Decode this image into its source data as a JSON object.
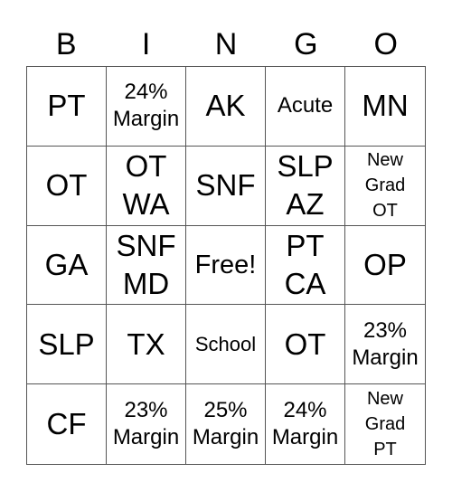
{
  "header": {
    "letters": [
      "B",
      "I",
      "N",
      "G",
      "O"
    ]
  },
  "cells": [
    "PT",
    "24%\nMargin",
    "AK",
    "Acute",
    "MN",
    "OT",
    "OT\nWA",
    "SNF",
    "SLP\nAZ",
    "New\nGrad\nOT",
    "GA",
    "SNF\nMD",
    "Free!",
    "PT\nCA",
    "OP",
    "SLP",
    "TX",
    "School",
    "OT",
    "23%\nMargin",
    "CF",
    "23%\nMargin",
    "25%\nMargin",
    "24%\nMargin",
    "New\nGrad\nPT"
  ]
}
